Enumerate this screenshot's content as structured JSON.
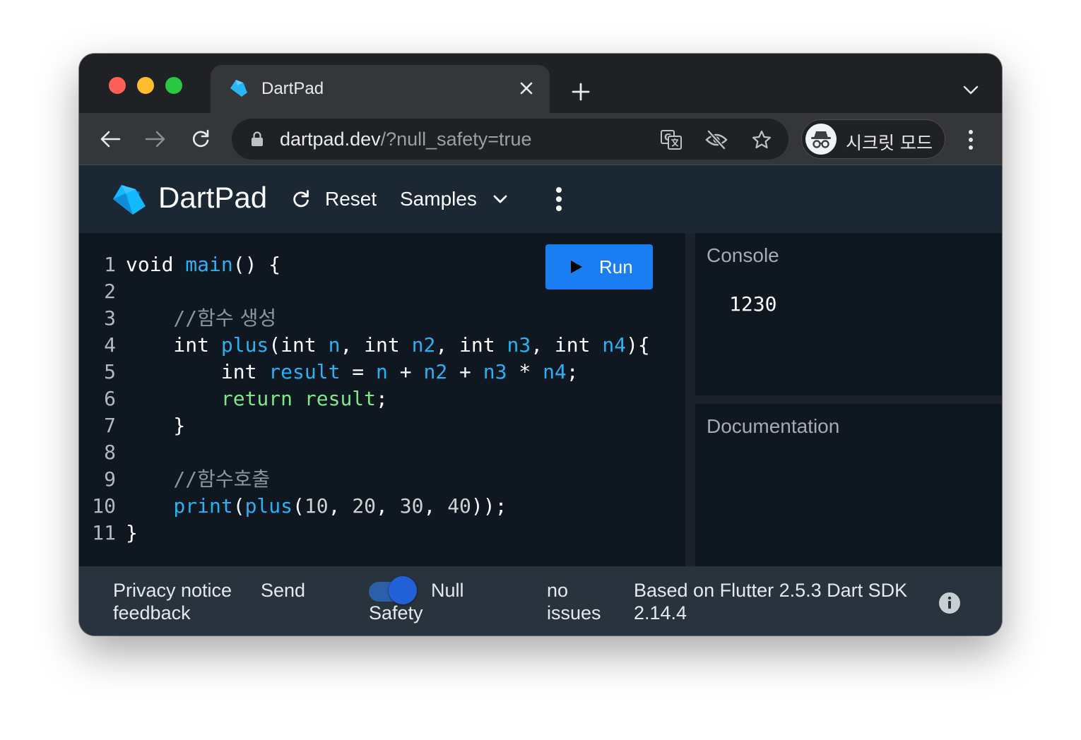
{
  "browser": {
    "tab": {
      "title": "DartPad",
      "favicon": "dart-logo-icon"
    },
    "address": {
      "host": "dartpad.dev",
      "path": "/?null_safety=true"
    },
    "incognito_label": "시크릿 모드",
    "colors": {
      "close": "#fe5f57",
      "minimize": "#febc2e",
      "maximize": "#28c840"
    }
  },
  "app": {
    "title": "DartPad",
    "reset_label": "Reset",
    "samples_label": "Samples",
    "run_label": "Run",
    "accent": "#1a7ef2"
  },
  "editor": {
    "line_numbers": [
      "1",
      "2",
      "3",
      "4",
      "5",
      "6",
      "7",
      "8",
      "9",
      "10",
      "11"
    ],
    "lines": [
      [
        {
          "t": "void ",
          "c": "kw"
        },
        {
          "t": "main",
          "c": "fn"
        },
        {
          "t": "() {",
          "c": "kw"
        }
      ],
      [],
      [
        {
          "t": "    //",
          "c": "cmt"
        },
        {
          "t": "함수 생성",
          "c": "cmt kor"
        }
      ],
      [
        {
          "t": "    int ",
          "c": "kw"
        },
        {
          "t": "plus",
          "c": "fn"
        },
        {
          "t": "(int ",
          "c": "kw"
        },
        {
          "t": "n",
          "c": "var"
        },
        {
          "t": ", int ",
          "c": "kw"
        },
        {
          "t": "n2",
          "c": "var"
        },
        {
          "t": ", int ",
          "c": "kw"
        },
        {
          "t": "n3",
          "c": "var"
        },
        {
          "t": ", int ",
          "c": "kw"
        },
        {
          "t": "n4",
          "c": "var"
        },
        {
          "t": "){",
          "c": "kw"
        }
      ],
      [
        {
          "t": "        int ",
          "c": "kw"
        },
        {
          "t": "result",
          "c": "var"
        },
        {
          "t": " = ",
          "c": "kw"
        },
        {
          "t": "n",
          "c": "var"
        },
        {
          "t": " + ",
          "c": "kw"
        },
        {
          "t": "n2",
          "c": "var"
        },
        {
          "t": " + ",
          "c": "kw"
        },
        {
          "t": "n3",
          "c": "var"
        },
        {
          "t": " * ",
          "c": "kw"
        },
        {
          "t": "n4",
          "c": "var"
        },
        {
          "t": ";",
          "c": "kw"
        }
      ],
      [
        {
          "t": "        return ",
          "c": "ret"
        },
        {
          "t": "result",
          "c": "ret"
        },
        {
          "t": ";",
          "c": "kw"
        }
      ],
      [
        {
          "t": "    }",
          "c": "kw"
        }
      ],
      [],
      [
        {
          "t": "    //",
          "c": "cmt"
        },
        {
          "t": "함수호출",
          "c": "cmt kor"
        }
      ],
      [
        {
          "t": "    print",
          "c": "fn"
        },
        {
          "t": "(",
          "c": "kw"
        },
        {
          "t": "plus",
          "c": "fn"
        },
        {
          "t": "(",
          "c": "kw"
        },
        {
          "t": "10",
          "c": "num"
        },
        {
          "t": ", ",
          "c": "kw"
        },
        {
          "t": "20",
          "c": "num"
        },
        {
          "t": ", ",
          "c": "kw"
        },
        {
          "t": "30",
          "c": "num"
        },
        {
          "t": ", ",
          "c": "kw"
        },
        {
          "t": "40",
          "c": "num"
        },
        {
          "t": "));",
          "c": "kw"
        }
      ],
      [
        {
          "t": "}",
          "c": "kw"
        }
      ]
    ]
  },
  "console": {
    "title": "Console",
    "output": "1230"
  },
  "documentation": {
    "title": "Documentation"
  },
  "footer": {
    "privacy_line1": "Privacy notice",
    "privacy_line2": "feedback",
    "send_label": "Send",
    "null_line1": "Null",
    "null_line2": "Safety",
    "null_safety_enabled": true,
    "issues_line1": "no",
    "issues_line2": "issues",
    "sdk_line1": "Based on Flutter 2.5.3 Dart SDK",
    "sdk_line2": "2.14.4"
  }
}
